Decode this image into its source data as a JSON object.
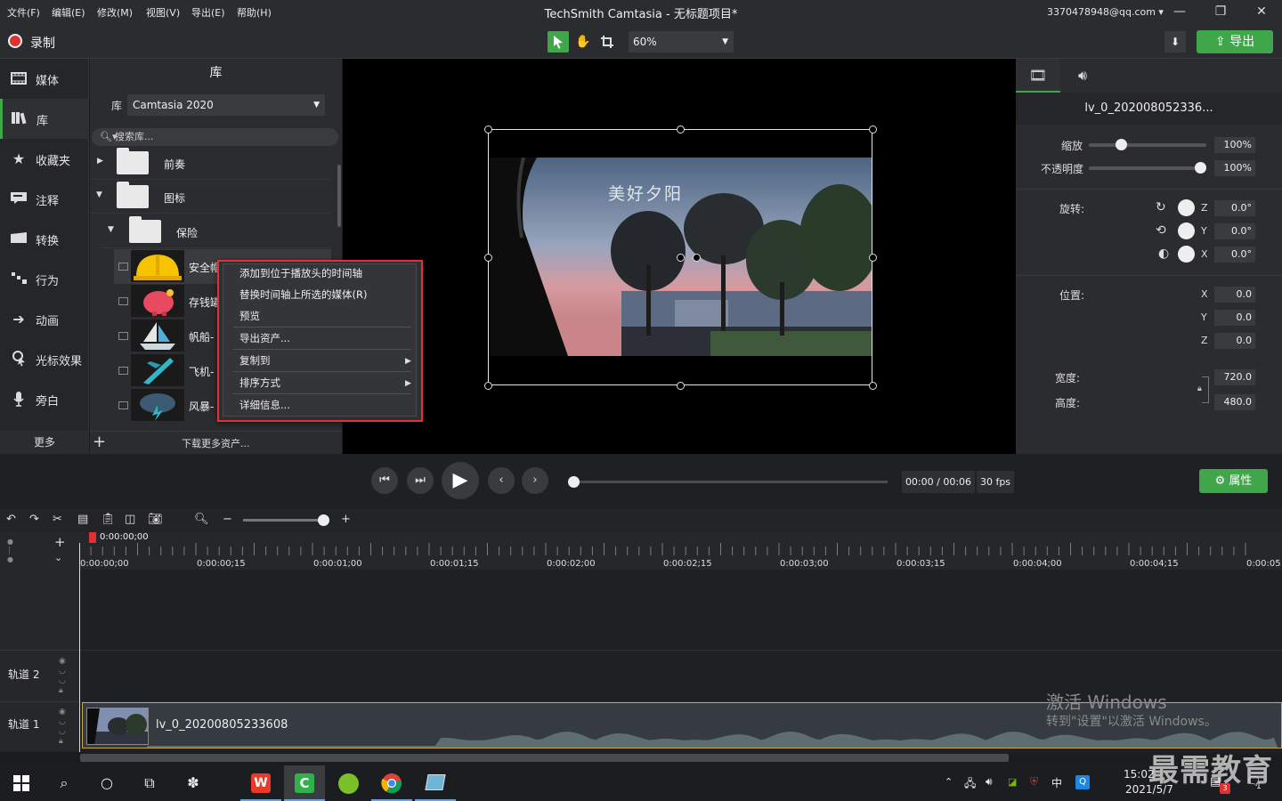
{
  "menu": [
    "文件(F)",
    "编辑(E)",
    "修改(M)",
    "视图(V)",
    "导出(E)",
    "帮助(H)"
  ],
  "app_title": "TechSmith Camtasia - 无标题项目*",
  "account": "3370478948@qq.com ▾",
  "window_buttons": [
    "—",
    "❐",
    "✕"
  ],
  "toolbar": {
    "record_label": "录制",
    "zoom_value": "60%",
    "export_label": "导出"
  },
  "sidebar": {
    "items": [
      {
        "label": "媒体",
        "icon": "film-icon"
      },
      {
        "label": "库",
        "icon": "library-icon"
      },
      {
        "label": "收藏夹",
        "icon": "star-icon"
      },
      {
        "label": "注释",
        "icon": "annotation-icon"
      },
      {
        "label": "转换",
        "icon": "transition-icon"
      },
      {
        "label": "行为",
        "icon": "behavior-icon"
      },
      {
        "label": "动画",
        "icon": "animation-icon"
      },
      {
        "label": "光标效果",
        "icon": "cursor-icon"
      },
      {
        "label": "旁白",
        "icon": "mic-icon"
      }
    ],
    "more_label": "更多"
  },
  "library": {
    "header": "库",
    "select_label": "库",
    "selected": "Camtasia 2020",
    "search_placeholder": "搜索库...",
    "folders": [
      "前奏",
      "图标",
      "保险"
    ],
    "assets": [
      "安全帽",
      "存钱罐",
      "帆船-",
      "飞机-",
      "风暴-"
    ],
    "download_more": "下载更多资产..."
  },
  "context_menu": {
    "items": [
      "添加到位于播放头的时间轴",
      "替换时间轴上所选的媒体(R)",
      "预览",
      "导出资产...",
      "复制到",
      "排序方式",
      "详细信息..."
    ]
  },
  "canvas": {
    "overlay_text": "美好夕阳"
  },
  "properties": {
    "clip_name": "lv_0_202008052336...",
    "scale_label": "缩放",
    "scale_value": "100%",
    "scale_level": 0.25,
    "opacity_label": "不透明度",
    "opacity_value": "100%",
    "opacity_level": 1.0,
    "rotation_label": "旋转:",
    "rotation": [
      {
        "axis": "Z",
        "value": "0.0°"
      },
      {
        "axis": "Y",
        "value": "0.0°"
      },
      {
        "axis": "X",
        "value": "0.0°"
      }
    ],
    "position_label": "位置:",
    "position": [
      {
        "axis": "X",
        "value": "0.0"
      },
      {
        "axis": "Y",
        "value": "0.0"
      },
      {
        "axis": "Z",
        "value": "0.0"
      }
    ],
    "width_label": "宽度:",
    "width_value": "720.0",
    "height_label": "高度:",
    "height_value": "480.0"
  },
  "transport": {
    "timecode": "00:00 / 00:06",
    "fps": "30 fps",
    "attr_label": "属性"
  },
  "timeline": {
    "playhead_time": "0:00:00;00",
    "ticks": [
      "0:00:00;00",
      "0:00:00;15",
      "0:00:01;00",
      "0:00:01;15",
      "0:00:02;00",
      "0:00:02;15",
      "0:00:03;00",
      "0:00:03;15",
      "0:00:04;00",
      "0:00:04;15",
      "0:00:05"
    ],
    "tracks": [
      "轨道 2",
      "轨道 1"
    ],
    "clip_label": "lv_0_20200805233608"
  },
  "watermark": {
    "line1": "激活 Windows",
    "line2": "转到\"设置\"以激活 Windows。"
  },
  "taskbar": {
    "time": "15:02",
    "date": "2021/5/7",
    "ime": "中",
    "badge": "3",
    "notif": "1"
  },
  "brand": "最需教育"
}
